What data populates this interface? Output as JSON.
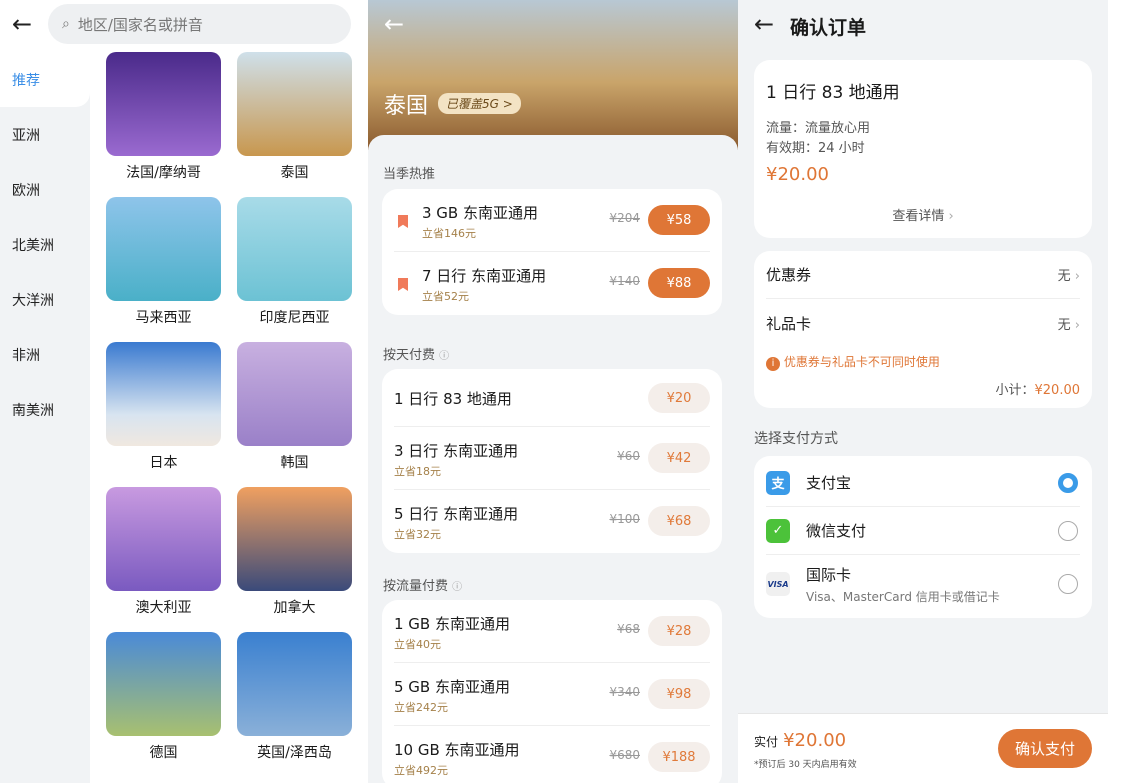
{
  "country_list": {
    "search_placeholder": "地区/国家名或拼音",
    "categories": [
      "推荐",
      "亚洲",
      "欧洲",
      "北美洲",
      "大洋洲",
      "非洲",
      "南美洲"
    ],
    "destinations": [
      "法国/摩纳哥",
      "泰国",
      "马来西亚",
      "印度尼西亚",
      "日本",
      "韩国",
      "澳大利亚",
      "加拿大",
      "德国",
      "英国/泽西岛"
    ]
  },
  "country_detail": {
    "title": "泰国",
    "badge": "已覆盖5G >",
    "sections": [
      {
        "title": "当季热推",
        "items": [
          {
            "name": "3 GB 东南亚通用",
            "save": "立省146元",
            "original": "¥204",
            "price": "¥58"
          },
          {
            "name": "7 日行 东南亚通用",
            "save": "立省52元",
            "original": "¥140",
            "price": "¥88"
          }
        ]
      },
      {
        "title": "按天付费",
        "items": [
          {
            "name": "1 日行  83 地通用",
            "price": "¥20"
          },
          {
            "name": "3 日行 东南亚通用",
            "save": "立省18元",
            "original": "¥60",
            "price": "¥42"
          },
          {
            "name": "5 日行 东南亚通用",
            "save": "立省32元",
            "original": "¥100",
            "price": "¥68"
          }
        ]
      },
      {
        "title": "按流量付费",
        "items": [
          {
            "name": "1 GB 东南亚通用",
            "save": "立省40元",
            "original": "¥68",
            "price": "¥28"
          },
          {
            "name": "5 GB 东南亚通用",
            "save": "立省242元",
            "original": "¥340",
            "price": "¥98"
          },
          {
            "name": "10 GB 东南亚通用",
            "save": "立省492元",
            "original": "¥680",
            "price": "¥188"
          }
        ]
      }
    ]
  },
  "order": {
    "title": "确认订单",
    "plan": "1 日行 83 地通用",
    "traffic": "流量：流量放心用",
    "validity": "有效期：24 小时",
    "price": "¥20.00",
    "details": "查看详情",
    "coupon_label": "优惠券",
    "coupon_value": "无",
    "gift_label": "礼品卡",
    "gift_value": "无",
    "warning": "优惠券与礼品卡不可同时使用",
    "subtotal_label": "小计：",
    "subtotal": "¥20.00",
    "pay_title": "选择支付方式",
    "methods": [
      {
        "name": "支付宝"
      },
      {
        "name": "微信支付"
      },
      {
        "name": "国际卡",
        "sub": "Visa、MasterCard 信用卡或借记卡",
        "icon_text": "VISA"
      }
    ],
    "total_label": "实付",
    "total": "¥20.00",
    "note": "*预订后 30 天内启用有效",
    "confirm": "确认支付"
  },
  "colors": {
    "accent": "#df7636",
    "blue": "#3a9be8"
  }
}
